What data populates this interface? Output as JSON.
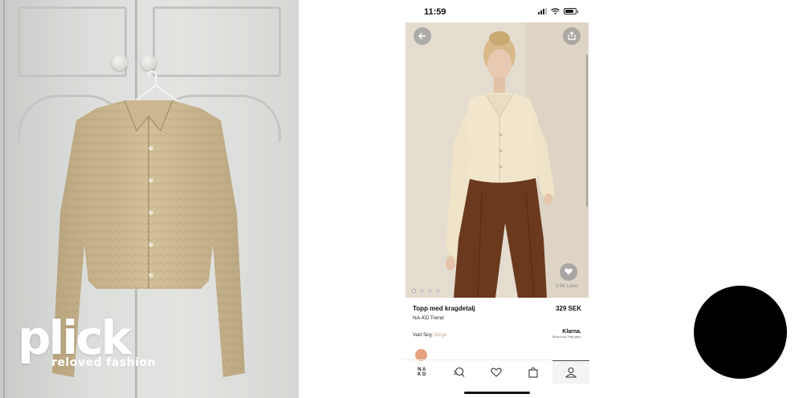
{
  "left_panel": {
    "logo": {
      "word": "plick",
      "tagline": "reloved fashion"
    }
  },
  "phone": {
    "status": {
      "time": "11:59"
    },
    "icons": {
      "back": "arrow-left-icon",
      "share": "share-icon",
      "favorite": "heart-icon",
      "tabs": [
        "nakd-logo",
        "search-icon",
        "heart-icon",
        "bag-icon",
        "user-icon"
      ]
    },
    "image": {
      "likes": "3.6K Likes",
      "carousel_dots": 4,
      "active_dot": 0
    },
    "product": {
      "title": "Topp med kragdetalj",
      "price": "329 SEK",
      "brand": "NA-KD Trend",
      "color_label": "Vald färg:",
      "color_value": "Beige",
      "swatch_color": "#e4a37e",
      "klarna_logo": "Klarna.",
      "klarna_sub": "Shop now. Pay later."
    },
    "tabbar": {
      "brand_lines": [
        "N A",
        "K D"
      ],
      "active_index": 4
    }
  },
  "colors": {
    "overlay_circle": "#000000",
    "price_text": "#111111",
    "color_value": "#d4a68c"
  }
}
